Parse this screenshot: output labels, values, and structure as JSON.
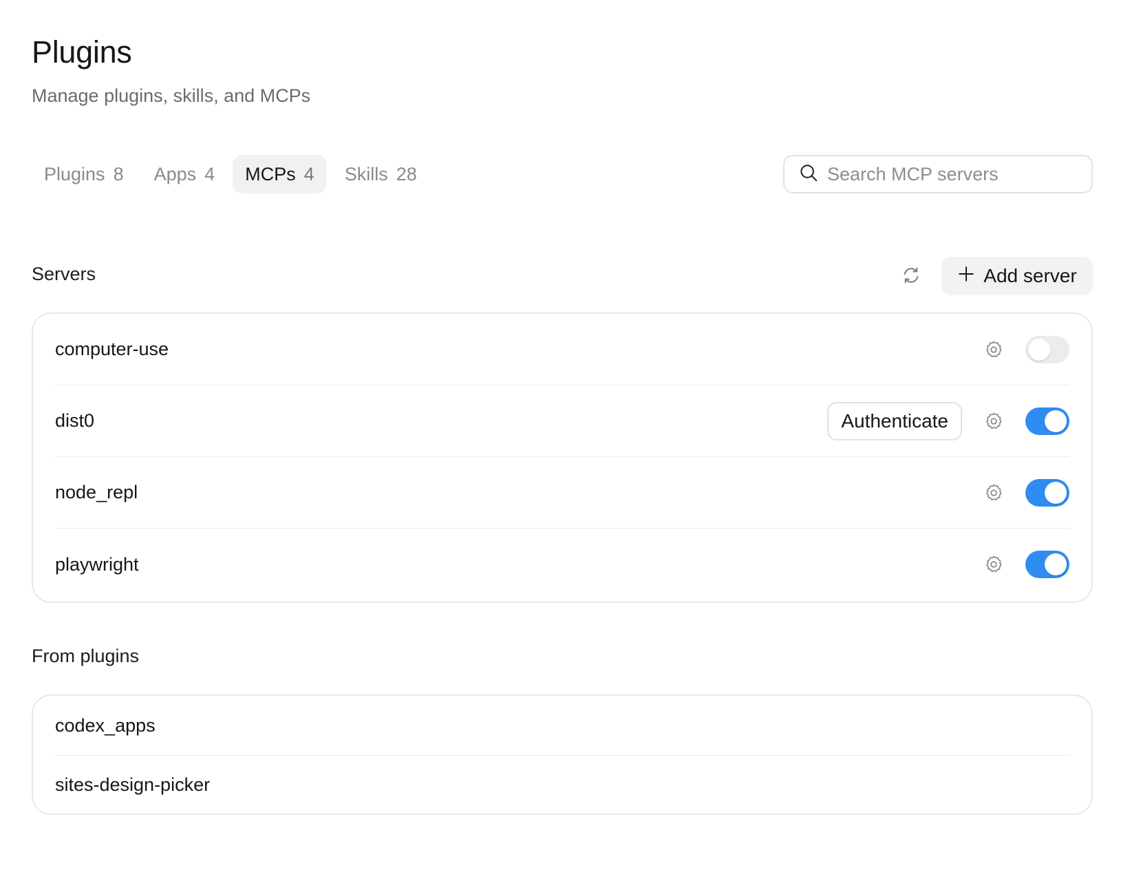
{
  "header": {
    "title": "Plugins",
    "subtitle": "Manage plugins, skills, and MCPs"
  },
  "tabs": [
    {
      "label": "Plugins",
      "count": "8",
      "active": false
    },
    {
      "label": "Apps",
      "count": "4",
      "active": false
    },
    {
      "label": "MCPs",
      "count": "4",
      "active": true
    },
    {
      "label": "Skills",
      "count": "28",
      "active": false
    }
  ],
  "search": {
    "placeholder": "Search MCP servers",
    "value": "",
    "icon": "search-icon"
  },
  "servers_section": {
    "title": "Servers",
    "refresh_icon": "refresh-icon",
    "add_button_label": "Add server",
    "add_icon": "plus-icon",
    "servers": [
      {
        "name": "computer-use",
        "enabled": false,
        "auth_label": null
      },
      {
        "name": "dist0",
        "enabled": true,
        "auth_label": "Authenticate"
      },
      {
        "name": "node_repl",
        "enabled": true,
        "auth_label": null
      },
      {
        "name": "playwright",
        "enabled": true,
        "auth_label": null
      }
    ]
  },
  "plugins_section": {
    "title": "From plugins",
    "items": [
      {
        "name": "codex_apps"
      },
      {
        "name": "sites-design-picker"
      }
    ]
  },
  "colors": {
    "toggle_on": "#2f8df2",
    "toggle_off": "#ececec",
    "active_tab_bg": "#f1f1f1"
  }
}
